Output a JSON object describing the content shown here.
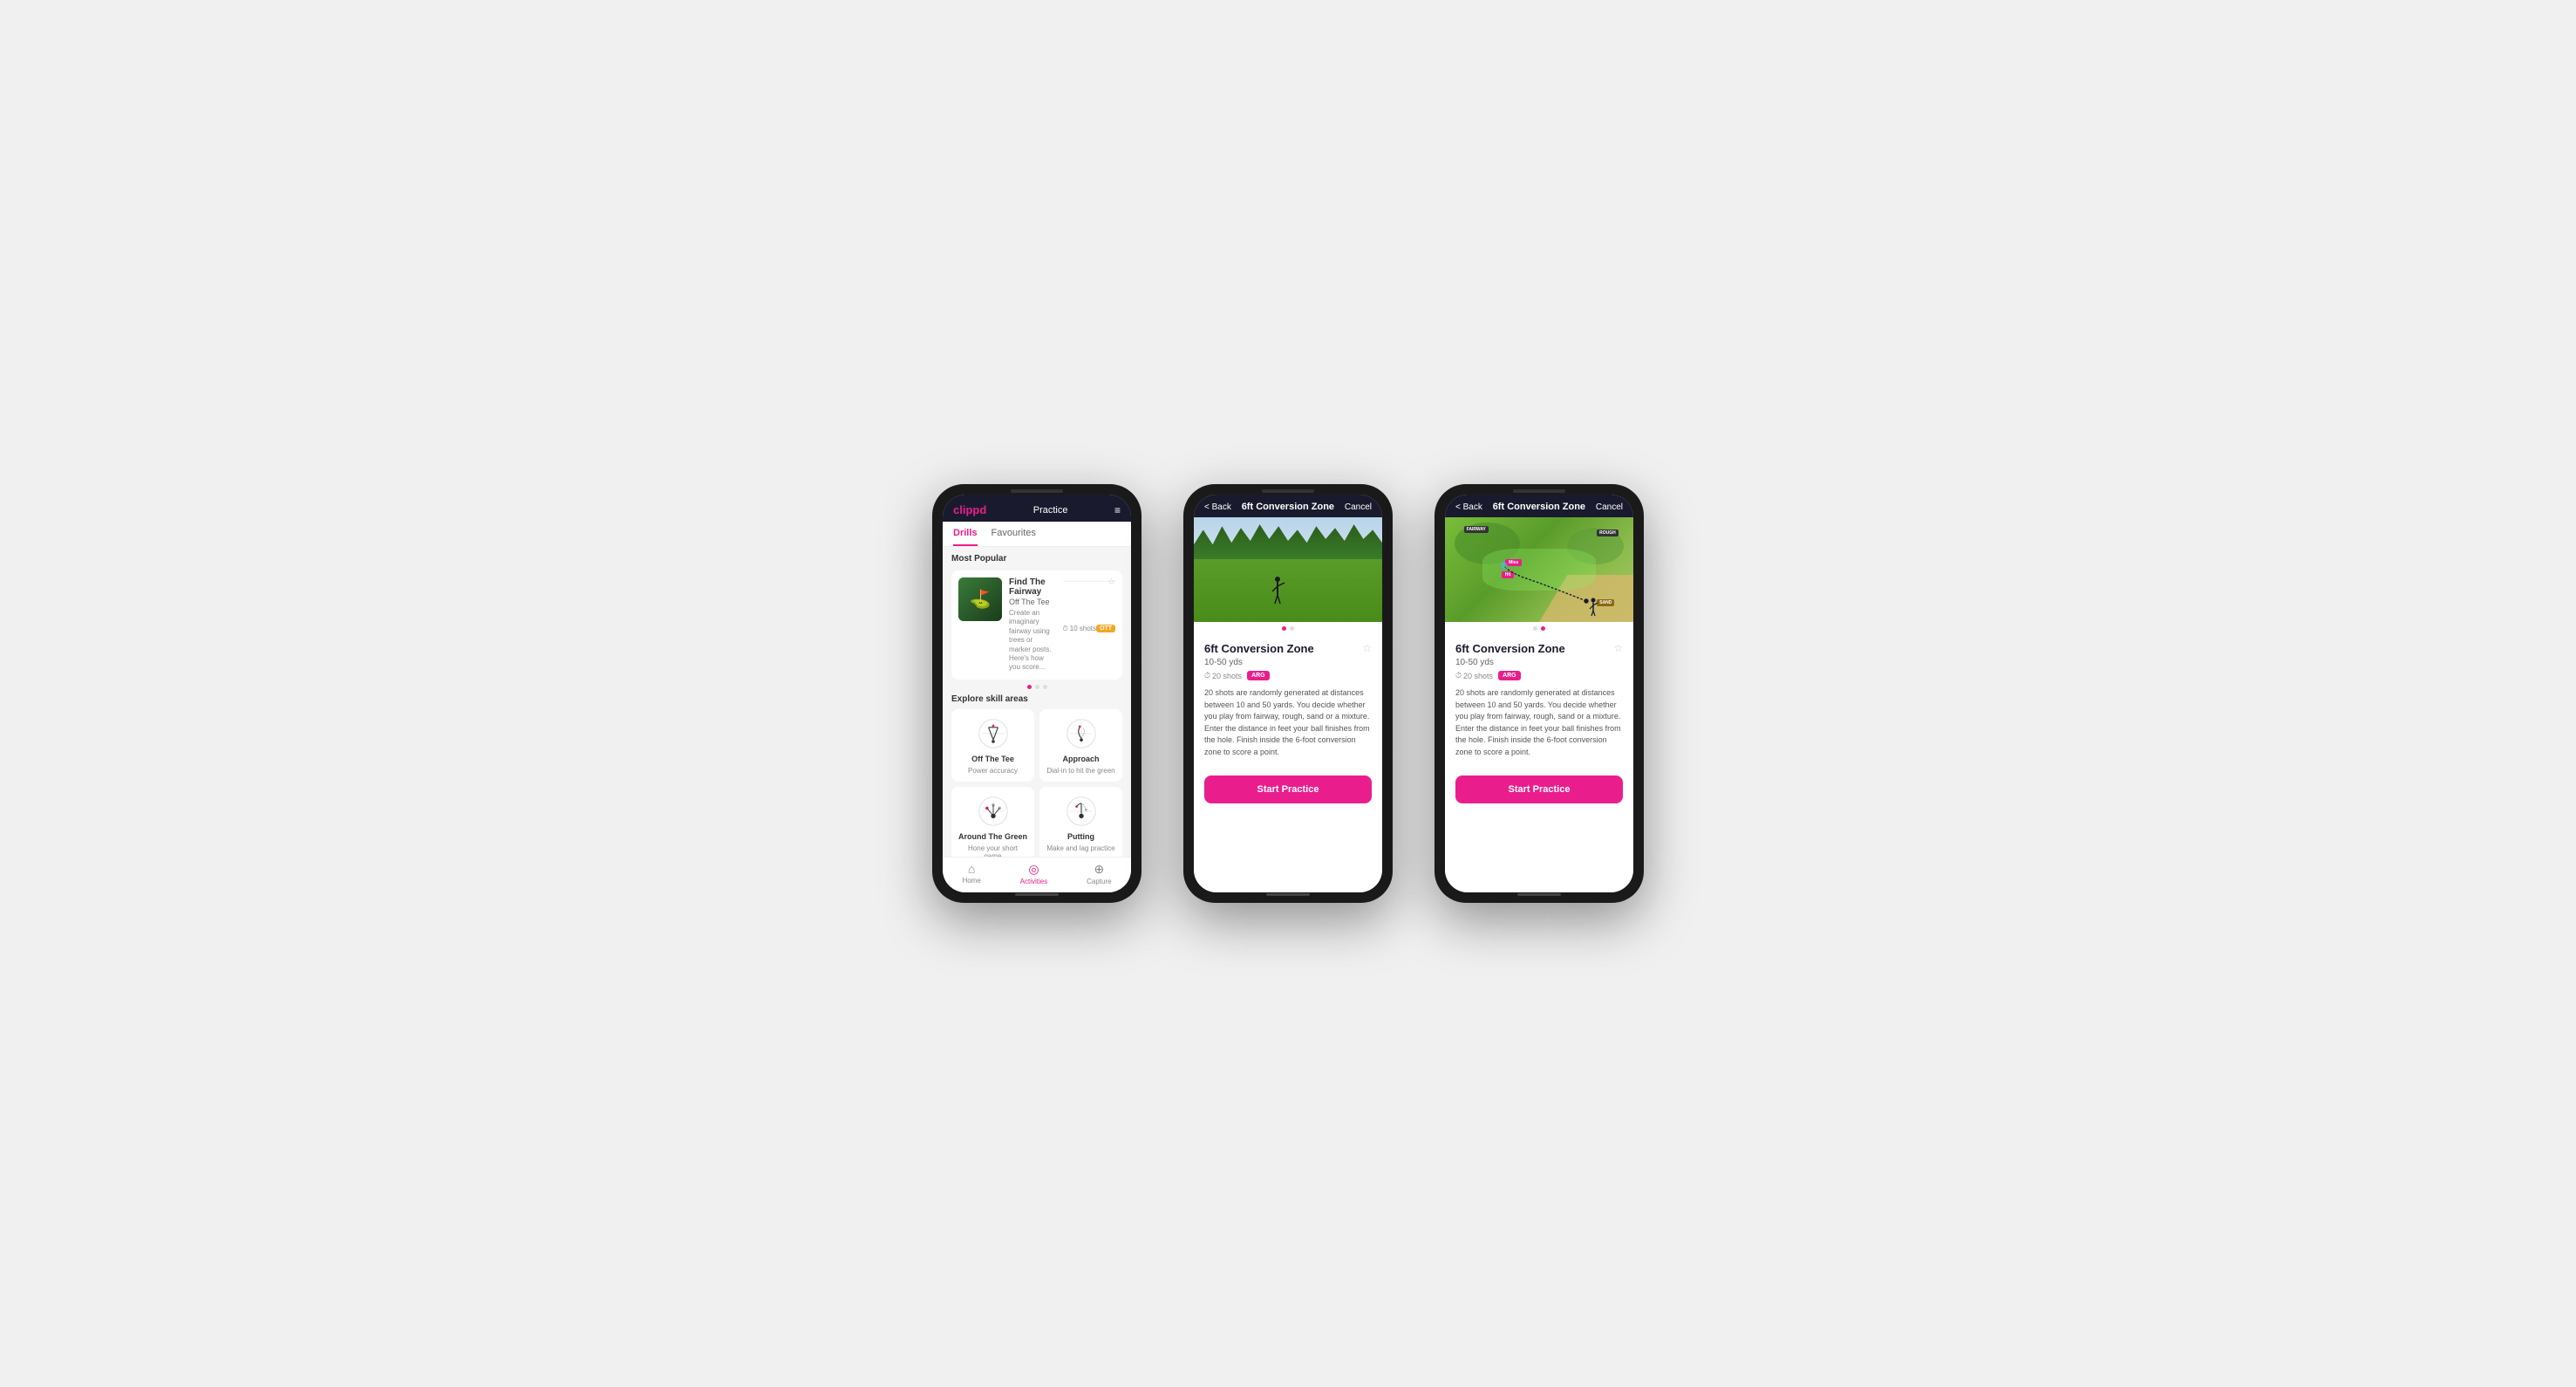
{
  "phone1": {
    "header": {
      "logo": "clippd",
      "title": "Practice",
      "menu_icon": "≡"
    },
    "tabs": [
      "Drills",
      "Favourites"
    ],
    "active_tab": "Drills",
    "most_popular_label": "Most Popular",
    "card": {
      "title": "Find The Fairway",
      "subtitle": "Off The Tee",
      "description": "Create an imaginary fairway using trees or marker posts. Here's how you score...",
      "shots": "10 shots",
      "badge": "OTT",
      "star": "☆"
    },
    "explore_label": "Explore skill areas",
    "skills": [
      {
        "name": "Off The Tee",
        "desc": "Power accuracy",
        "icon": "ott"
      },
      {
        "name": "Approach",
        "desc": "Dial-in to hit the green",
        "icon": "approach"
      },
      {
        "name": "Around The Green",
        "desc": "Hone your short game",
        "icon": "atg"
      },
      {
        "name": "Putting",
        "desc": "Make and lag practice",
        "icon": "putting"
      }
    ],
    "nav": [
      {
        "label": "Home",
        "icon": "🏠",
        "active": false
      },
      {
        "label": "Activities",
        "icon": "◎",
        "active": true
      },
      {
        "label": "Capture",
        "icon": "⊕",
        "active": false
      }
    ]
  },
  "phone2": {
    "header": {
      "back_label": "< Back",
      "title": "6ft Conversion Zone",
      "cancel_label": "Cancel"
    },
    "drill": {
      "title": "6ft Conversion Zone",
      "yardage": "10-50 yds",
      "shots": "20 shots",
      "badge": "ARG",
      "star": "☆",
      "description": "20 shots are randomly generated at distances between 10 and 50 yards. You decide whether you play from fairway, rough, sand or a mixture. Enter the distance in feet your ball finishes from the hole. Finish inside the 6-foot conversion zone to score a point."
    },
    "start_button": "Start Practice",
    "image_type": "photo",
    "dots": 2
  },
  "phone3": {
    "header": {
      "back_label": "< Back",
      "title": "6ft Conversion Zone",
      "cancel_label": "Cancel"
    },
    "drill": {
      "title": "6ft Conversion Zone",
      "yardage": "10-50 yds",
      "shots": "20 shots",
      "badge": "ARG",
      "star": "☆",
      "description": "20 shots are randomly generated at distances between 10 and 50 yards. You decide whether you play from fairway, rough, sand or a mixture. Enter the distance in feet your ball finishes from the hole. Finish inside the 6-foot conversion zone to score a point."
    },
    "start_button": "Start Practice",
    "image_type": "map",
    "dots": 2
  }
}
